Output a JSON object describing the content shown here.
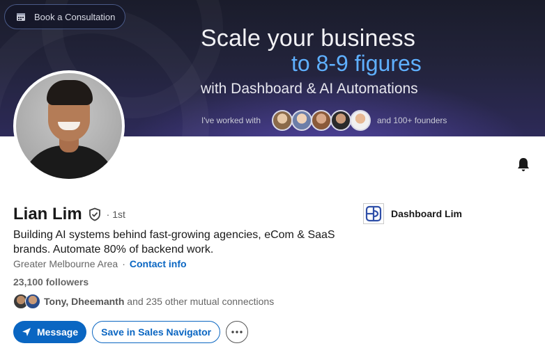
{
  "banner": {
    "consult_label": "Book a Consultation",
    "headline_line1": "Scale your business",
    "headline_line2": "to 8-9 figures",
    "headline_line3": "with Dashboard & AI Automations",
    "worked_with": "I've worked with",
    "founders": "and 100+ founders",
    "accent_color": "#5fb0ff"
  },
  "profile": {
    "name": "Lian Lim",
    "degree": "· 1st",
    "headline": "Building AI systems behind fast-growing agencies, eCom & SaaS brands. Automate 80% of backend work.",
    "location": "Greater Melbourne Area",
    "location_separator": "·",
    "contact_label": "Contact info",
    "followers": "23,100 followers",
    "mutual_names": "Tony, Dheemanth",
    "mutual_rest": "and 235 other mutual connections"
  },
  "company": {
    "name": "Dashboard Lim"
  },
  "actions": {
    "message_label": "Message",
    "sales_nav_label": "Save in Sales Navigator",
    "more_icon": "ellipsis-icon"
  },
  "colors": {
    "primary": "#0a66c2"
  }
}
